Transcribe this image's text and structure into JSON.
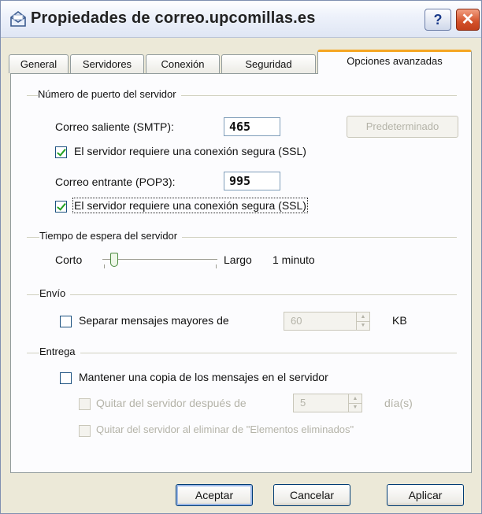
{
  "window": {
    "title": "Propiedades de correo.upcomillas.es",
    "help_label": "?",
    "close_label": "✕"
  },
  "tabs": [
    {
      "label": "General",
      "active": false
    },
    {
      "label": "Servidores",
      "active": false
    },
    {
      "label": "Conexión",
      "active": false
    },
    {
      "label": "Seguridad",
      "active": false
    },
    {
      "label": "Opciones avanzadas",
      "active": true
    }
  ],
  "ports": {
    "group_label": "Número de puerto del servidor",
    "smtp_label": "Correo saliente (SMTP):",
    "smtp_value": "465",
    "default_button": "Predeterminado",
    "smtp_ssl_label": "El servidor requiere una conexión segura (SSL)",
    "smtp_ssl_checked": true,
    "pop3_label": "Correo entrante (POP3):",
    "pop3_value": "995",
    "pop3_ssl_label": "El servidor requiere una conexión segura (SSL)",
    "pop3_ssl_checked": true
  },
  "timeout": {
    "group_label": "Tiempo de espera del servidor",
    "short_label": "Corto",
    "long_label": "Largo",
    "value_label": "1 minuto",
    "level": 0.1
  },
  "sending": {
    "group_label": "Envío",
    "split_label": "Separar mensajes mayores de",
    "split_checked": false,
    "split_value": "60",
    "unit_label": "KB"
  },
  "delivery": {
    "group_label": "Entrega",
    "keep_copy_label": "Mantener una copia de los mensajes en el servidor",
    "keep_copy_checked": false,
    "remove_after_label": "Quitar del servidor después de",
    "remove_after_value": "5",
    "days_label": "día(s)",
    "remove_deleted_label": "Quitar del servidor al eliminar de \"Elementos eliminados\""
  },
  "footer": {
    "ok_label": "Aceptar",
    "cancel_label": "Cancelar",
    "apply_label": "Aplicar"
  },
  "icons": {
    "title_icon": "mail-account-icon",
    "help_icon": "help-icon",
    "close_icon": "close-icon"
  },
  "colors": {
    "dialog_bg": "#ece9d8",
    "active_tab_accent": "#f5a623",
    "check_color": "#21a121",
    "close_button": "#d3512a"
  }
}
